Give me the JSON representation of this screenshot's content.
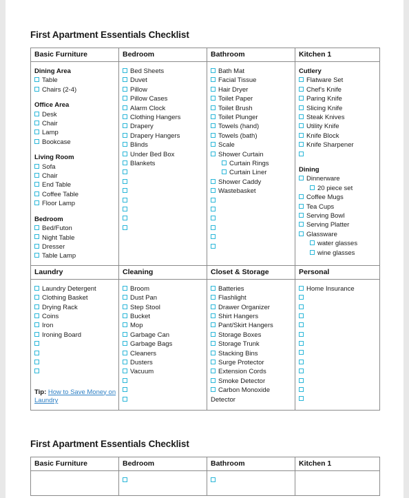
{
  "document": {
    "title": "First Apartment Essentials Checklist",
    "accent_color": "#29b6d8",
    "link_color": "#2c7fc4",
    "border_color": "#8a8a8a"
  },
  "table_one": {
    "row_one": {
      "headers": [
        "Basic Furniture",
        "Bedroom",
        "Bathroom",
        "Kitchen 1"
      ],
      "columns": [
        {
          "key": "basic-furniture",
          "blocks": [
            {
              "heading": "Dining Area",
              "items": [
                "Table",
                "Chairs (2-4)"
              ]
            },
            {
              "heading": "Office Area",
              "items": [
                "Desk",
                "Chair",
                "Lamp",
                "Bookcase"
              ]
            },
            {
              "heading": "Living Room",
              "items": [
                "Sofa",
                "Chair",
                "End Table",
                "Coffee Table",
                "Floor Lamp"
              ]
            },
            {
              "heading": "Bedroom",
              "items": [
                "Bed/Futon",
                "Night Table",
                "Dresser",
                "Table Lamp"
              ]
            }
          ],
          "empty_boxes": 0
        },
        {
          "key": "bedroom",
          "blocks": [
            {
              "heading": "",
              "items": [
                "Bed Sheets",
                "Duvet",
                "Pillow",
                "Pillow Cases",
                "Alarm Clock",
                "Clothing Hangers",
                "Drapery",
                "Drapery Hangers",
                "Blinds",
                "Under Bed Box",
                "Blankets"
              ]
            }
          ],
          "empty_boxes": 7
        },
        {
          "key": "bathroom",
          "blocks": [
            {
              "heading": "",
              "items": [
                "Bath Mat",
                "Facial Tissue",
                "Hair Dryer",
                "Toilet Paper",
                "Toilet Brush",
                "Toilet Plunger",
                "Towels (hand)",
                "Towels (bath)",
                "Scale",
                "Shower Curtain"
              ]
            },
            {
              "heading": "",
              "sub_items": [
                "Curtain Rings",
                "Curtain Liner"
              ]
            },
            {
              "heading": "",
              "items": [
                "Shower Caddy",
                "Wastebasket"
              ]
            }
          ],
          "empty_boxes": 6
        },
        {
          "key": "kitchen-1",
          "blocks": [
            {
              "heading": "Cutlery",
              "items": [
                "Flatware Set",
                "Chef's Knife",
                "Paring Knife",
                "Slicing Knife",
                "Steak Knives",
                "Utility Knife",
                "Knife Block",
                "Knife Sharpener",
                ""
              ]
            },
            {
              "heading": "Dining",
              "items": [
                "Dinnerware"
              ]
            },
            {
              "heading": "",
              "sub_items": [
                "20 piece set"
              ]
            },
            {
              "heading": "",
              "items": [
                "Coffee Mugs",
                "Tea Cups",
                "Serving Bowl",
                "Serving Platter",
                "Glassware"
              ]
            },
            {
              "heading": "",
              "sub_items": [
                "water glasses",
                "wine glasses"
              ]
            }
          ],
          "empty_boxes": 0
        }
      ]
    },
    "row_two": {
      "headers": [
        "Laundry",
        "Cleaning",
        "Closet & Storage",
        "Personal"
      ],
      "columns": [
        {
          "key": "laundry",
          "items": [
            "Laundry Detergent",
            "Clothing Basket",
            "Drying Rack",
            "Coins",
            "Iron",
            "Ironing Board"
          ],
          "empty_boxes": 4,
          "tip": {
            "label": "Tip:",
            "link_text": "How to Save Money on Laundry"
          }
        },
        {
          "key": "cleaning",
          "items": [
            "Broom",
            "Dust Pan",
            "Step Stool",
            "Bucket",
            "Mop",
            "Garbage Can",
            "Garbage Bags",
            "Cleaners",
            "Dusters",
            "Vacuum"
          ],
          "empty_boxes": 3
        },
        {
          "key": "closet-storage",
          "items": [
            "Batteries",
            "Flashlight",
            "Drawer Organizer",
            "Shirt Hangers",
            "Pant/Skirt Hangers",
            "Storage Boxes",
            "Storage Trunk",
            "Stacking Bins",
            "Surge Protector",
            "Extension Cords",
            "Smoke Detector",
            "Carbon Monoxide Detector"
          ],
          "empty_boxes": 0
        },
        {
          "key": "personal",
          "items": [
            "Home Insurance"
          ],
          "empty_boxes": 12
        }
      ]
    }
  },
  "table_two": {
    "headers": [
      "Basic Furniture",
      "Bedroom",
      "Bathroom",
      "Kitchen 1"
    ],
    "columns": [
      {
        "key": "basic-furniture",
        "empty_boxes": 0
      },
      {
        "key": "bedroom",
        "empty_boxes": 1
      },
      {
        "key": "bathroom",
        "empty_boxes": 1
      },
      {
        "key": "kitchen-1",
        "empty_boxes": 0
      }
    ]
  }
}
